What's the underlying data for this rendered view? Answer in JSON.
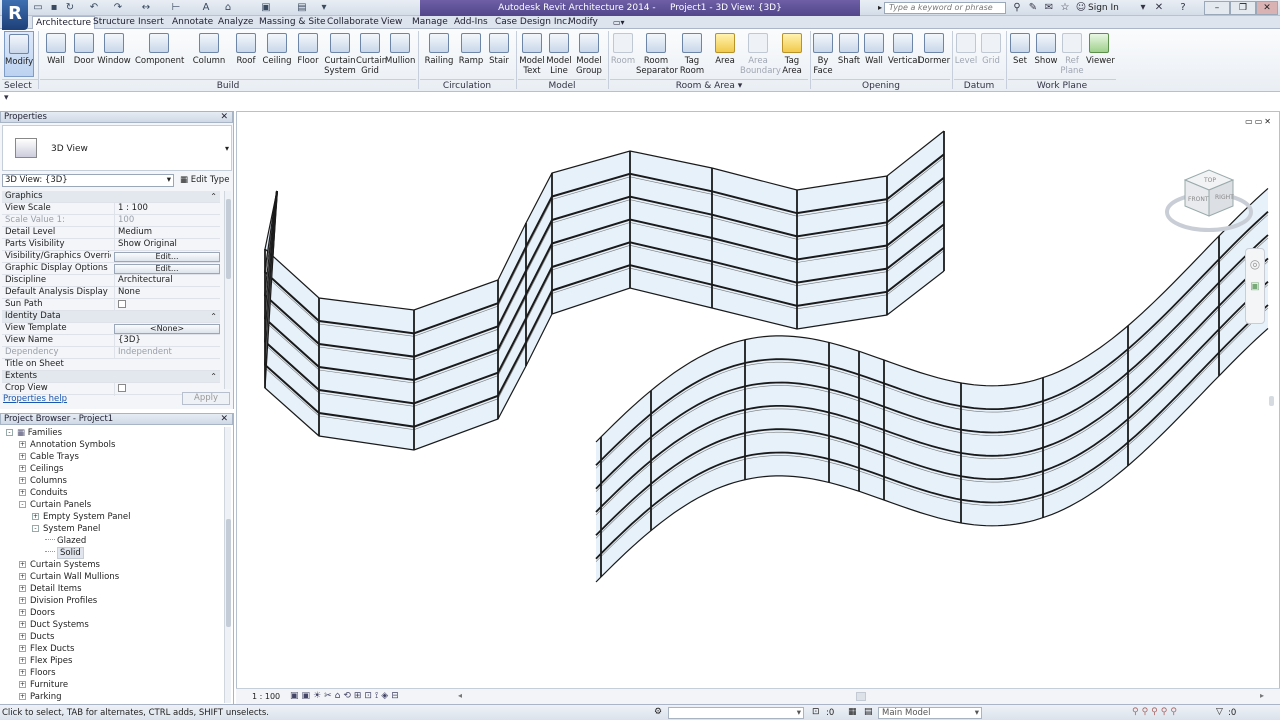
{
  "window": {
    "title": "Autodesk Revit Architecture 2014 -",
    "doc_title": "Project1 - 3D View: {3D}",
    "search_placeholder": "Type a keyword or phrase",
    "sign_in": "Sign In",
    "app_letter": "R"
  },
  "tabs": [
    "Architecture",
    "Structure",
    "Insert",
    "Annotate",
    "Analyze",
    "Massing & Site",
    "Collaborate",
    "View",
    "Manage",
    "Add-Ins",
    "Case Design Inc.",
    "Modify"
  ],
  "ribbon": {
    "buttons": [
      {
        "label": "Modify",
        "label2": ""
      },
      {
        "label": "Wall",
        "label2": ""
      },
      {
        "label": "Door",
        "label2": ""
      },
      {
        "label": "Window",
        "label2": ""
      },
      {
        "label": "Component",
        "label2": ""
      },
      {
        "label": "Column",
        "label2": ""
      },
      {
        "label": "Roof",
        "label2": ""
      },
      {
        "label": "Ceiling",
        "label2": ""
      },
      {
        "label": "Floor",
        "label2": ""
      },
      {
        "label": "Curtain",
        "label2": "System"
      },
      {
        "label": "Curtain",
        "label2": "Grid"
      },
      {
        "label": "Mullion",
        "label2": ""
      },
      {
        "label": "Railing",
        "label2": ""
      },
      {
        "label": "Ramp",
        "label2": ""
      },
      {
        "label": "Stair",
        "label2": ""
      },
      {
        "label": "Model",
        "label2": "Text"
      },
      {
        "label": "Model",
        "label2": "Line"
      },
      {
        "label": "Model",
        "label2": "Group"
      },
      {
        "label": "Room",
        "label2": ""
      },
      {
        "label": "Room",
        "label2": "Separator"
      },
      {
        "label": "Tag",
        "label2": "Room"
      },
      {
        "label": "Area",
        "label2": ""
      },
      {
        "label": "Area",
        "label2": "Boundary"
      },
      {
        "label": "Tag",
        "label2": "Area"
      },
      {
        "label": "By",
        "label2": "Face"
      },
      {
        "label": "Shaft",
        "label2": ""
      },
      {
        "label": "Wall",
        "label2": ""
      },
      {
        "label": "Vertical",
        "label2": ""
      },
      {
        "label": "Dormer",
        "label2": ""
      },
      {
        "label": "Level",
        "label2": ""
      },
      {
        "label": "Grid",
        "label2": ""
      },
      {
        "label": "Set",
        "label2": ""
      },
      {
        "label": "Show",
        "label2": ""
      },
      {
        "label": "Ref",
        "label2": "Plane"
      },
      {
        "label": "Viewer",
        "label2": ""
      }
    ],
    "panels": [
      "Select ▾",
      "Build",
      "Circulation",
      "Model",
      "Room & Area ▾",
      "Opening",
      "Datum",
      "Work Plane"
    ]
  },
  "properties": {
    "title": "Properties",
    "type_name": "3D View",
    "selector": "3D View: {3D}",
    "edit_type": "Edit Type",
    "rows": [
      {
        "k": "Graphics",
        "v": "",
        "kind": "group"
      },
      {
        "k": "View Scale",
        "v": "1 : 100",
        "kind": "row"
      },
      {
        "k": "Scale Value    1:",
        "v": "100",
        "kind": "dim"
      },
      {
        "k": "Detail Level",
        "v": "Medium",
        "kind": "row"
      },
      {
        "k": "Parts Visibility",
        "v": "Show Original",
        "kind": "row"
      },
      {
        "k": "Visibility/Graphics Overrides",
        "v": "Edit...",
        "kind": "btn"
      },
      {
        "k": "Graphic Display Options",
        "v": "Edit...",
        "kind": "btn"
      },
      {
        "k": "Discipline",
        "v": "Architectural",
        "kind": "row"
      },
      {
        "k": "Default Analysis Display S...",
        "v": "None",
        "kind": "row"
      },
      {
        "k": "Sun Path",
        "v": "",
        "kind": "check"
      },
      {
        "k": "Identity Data",
        "v": "",
        "kind": "group"
      },
      {
        "k": "View Template",
        "v": "<None>",
        "kind": "btn"
      },
      {
        "k": "View Name",
        "v": "{3D}",
        "kind": "row"
      },
      {
        "k": "Dependency",
        "v": "Independent",
        "kind": "dim"
      },
      {
        "k": "Title on Sheet",
        "v": "",
        "kind": "row"
      },
      {
        "k": "Extents",
        "v": "",
        "kind": "group"
      },
      {
        "k": "Crop View",
        "v": "",
        "kind": "check"
      }
    ],
    "help": "Properties help",
    "apply": "Apply"
  },
  "browser": {
    "title": "Project Browser - Project1",
    "items": [
      {
        "label": "Families",
        "level": 0,
        "exp": "-"
      },
      {
        "label": "Annotation Symbols",
        "level": 1,
        "exp": "+"
      },
      {
        "label": "Cable Trays",
        "level": 1,
        "exp": "+"
      },
      {
        "label": "Ceilings",
        "level": 1,
        "exp": "+"
      },
      {
        "label": "Columns",
        "level": 1,
        "exp": "+"
      },
      {
        "label": "Conduits",
        "level": 1,
        "exp": "+"
      },
      {
        "label": "Curtain Panels",
        "level": 1,
        "exp": "-"
      },
      {
        "label": "Empty System Panel",
        "level": 2,
        "exp": "+"
      },
      {
        "label": "System Panel",
        "level": 2,
        "exp": "-"
      },
      {
        "label": "Glazed",
        "level": 3,
        "exp": ""
      },
      {
        "label": "Solid",
        "level": 3,
        "exp": ""
      },
      {
        "label": "Curtain Systems",
        "level": 1,
        "exp": "+"
      },
      {
        "label": "Curtain Wall Mullions",
        "level": 1,
        "exp": "+"
      },
      {
        "label": "Detail Items",
        "level": 1,
        "exp": "+"
      },
      {
        "label": "Division Profiles",
        "level": 1,
        "exp": "+"
      },
      {
        "label": "Doors",
        "level": 1,
        "exp": "+"
      },
      {
        "label": "Duct Systems",
        "level": 1,
        "exp": "+"
      },
      {
        "label": "Ducts",
        "level": 1,
        "exp": "+"
      },
      {
        "label": "Flex Ducts",
        "level": 1,
        "exp": "+"
      },
      {
        "label": "Flex Pipes",
        "level": 1,
        "exp": "+"
      },
      {
        "label": "Floors",
        "level": 1,
        "exp": "+"
      },
      {
        "label": "Furniture",
        "level": 1,
        "exp": "+"
      },
      {
        "label": "Parking",
        "level": 1,
        "exp": "+"
      }
    ]
  },
  "viewcube": {
    "top": "TOP",
    "front": "FRONT",
    "right": "RIGHT"
  },
  "view_bar": {
    "scale": "1 : 100"
  },
  "status": {
    "hint": "Click to select, TAB for alternates, CTRL adds, SHIFT unselects.",
    "count": ":0",
    "model": "Main Model"
  },
  "colors": {
    "glass": "#e6f1fa",
    "mullion": "#1a1a1a",
    "accent": "#3f6fb0"
  }
}
